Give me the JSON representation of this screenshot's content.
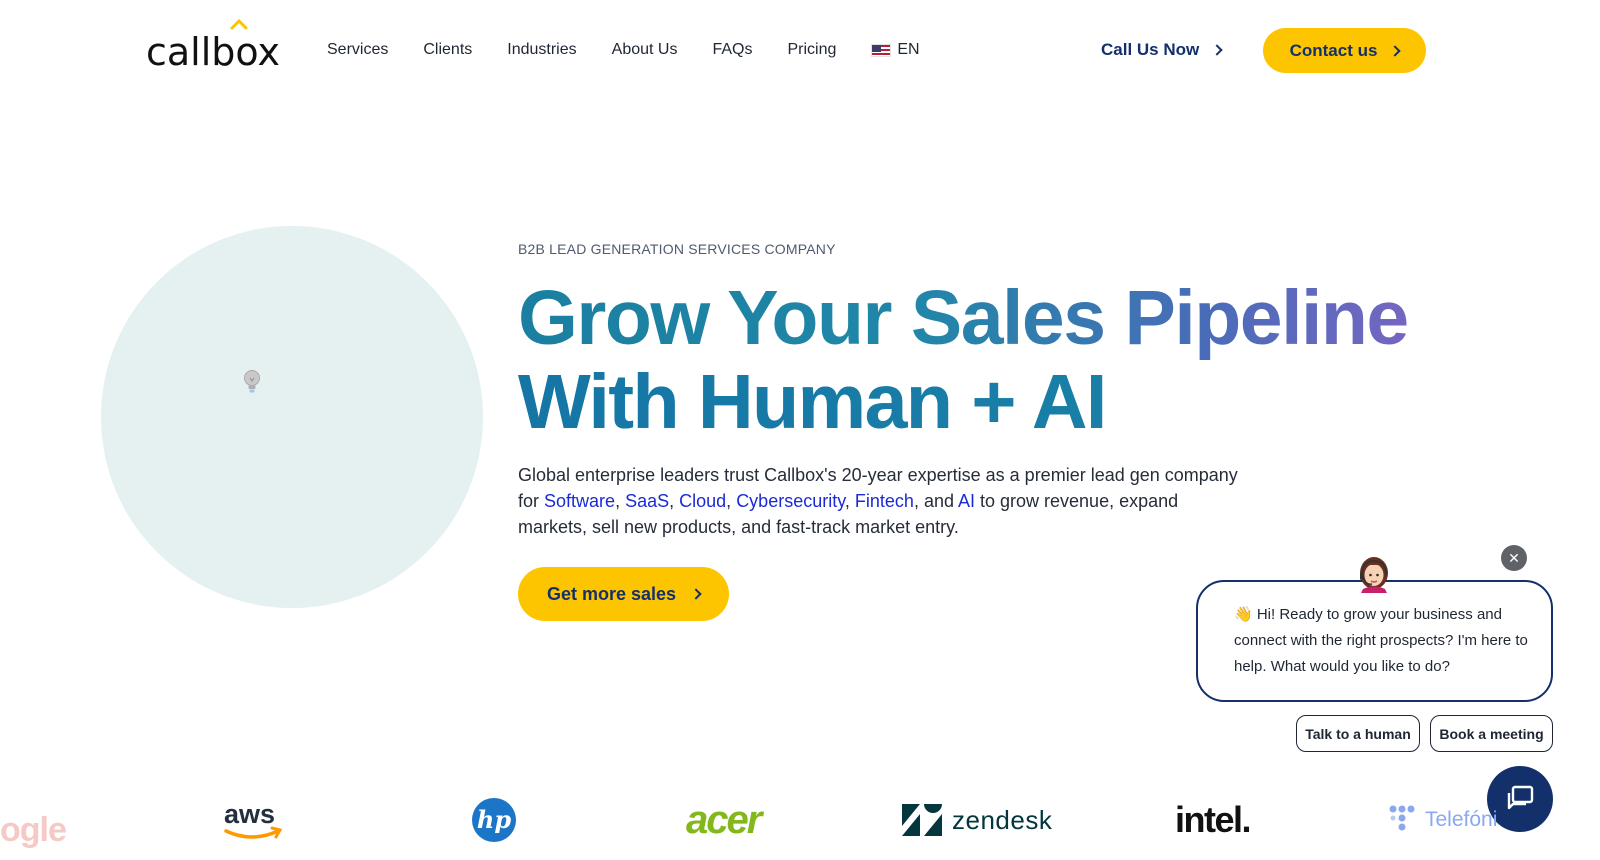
{
  "brand": {
    "logo_text": "callbox",
    "accent": "#fdc500",
    "navy": "#13306b"
  },
  "nav": {
    "items": [
      "Services",
      "Clients",
      "Industries",
      "About Us",
      "FAQs",
      "Pricing"
    ],
    "language": "EN",
    "call_now": "Call Us Now",
    "contact": "Contact us"
  },
  "hero": {
    "eyebrow": "B2B LEAD GENERATION SERVICES COMPANY",
    "headline_line1": "Grow Your Sales Pipeline",
    "headline_line2": "With Human + AI",
    "desc_intro": "Global enterprise leaders trust Callbox's 20-year expertise as a premier lead gen company for ",
    "links": [
      "Software",
      "SaaS",
      "Cloud",
      "Cybersecurity",
      "Fintech",
      "AI"
    ],
    "sep": ", ",
    "and": ", and ",
    "desc_outro": " to grow revenue, expand markets, sell new products, and fast-track market entry.",
    "cta": "Get more sales"
  },
  "chat": {
    "close": "✕",
    "message": "👋 Hi! Ready to grow your business and connect with the right prospects? I'm here to help. What would you like to do?",
    "option_1": "Talk to a human",
    "option_2": "Book a meeting"
  },
  "logos": {
    "google_partial": "ogle",
    "aws": "aws",
    "hp": "hp",
    "acer": "acer",
    "zendesk": "zendesk",
    "intel": "intel.",
    "telefonica_partial": "Telefóni"
  }
}
